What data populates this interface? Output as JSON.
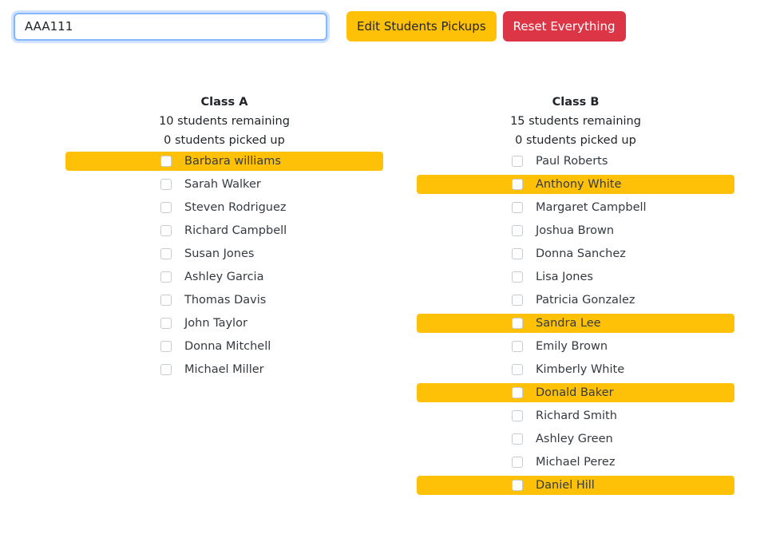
{
  "search": {
    "value": "AAA111"
  },
  "buttons": {
    "edit_label": "Edit Students Pickups",
    "reset_label": "Reset Everything"
  },
  "classes": [
    {
      "title": "Class A",
      "remaining": "10 students remaining",
      "picked_up": "0 students picked up",
      "students": [
        {
          "name": "Barbara williams",
          "highlighted": true,
          "checked": false
        },
        {
          "name": "Sarah Walker",
          "highlighted": false,
          "checked": false
        },
        {
          "name": "Steven Rodriguez",
          "highlighted": false,
          "checked": false
        },
        {
          "name": "Richard Campbell",
          "highlighted": false,
          "checked": false
        },
        {
          "name": "Susan Jones",
          "highlighted": false,
          "checked": false
        },
        {
          "name": "Ashley Garcia",
          "highlighted": false,
          "checked": false
        },
        {
          "name": "Thomas Davis",
          "highlighted": false,
          "checked": false
        },
        {
          "name": "John Taylor",
          "highlighted": false,
          "checked": false
        },
        {
          "name": "Donna Mitchell",
          "highlighted": false,
          "checked": false
        },
        {
          "name": "Michael Miller",
          "highlighted": false,
          "checked": false
        }
      ]
    },
    {
      "title": "Class B",
      "remaining": "15 students remaining",
      "picked_up": "0 students picked up",
      "students": [
        {
          "name": "Paul Roberts",
          "highlighted": false,
          "checked": false
        },
        {
          "name": "Anthony White",
          "highlighted": true,
          "checked": false
        },
        {
          "name": "Margaret Campbell",
          "highlighted": false,
          "checked": false
        },
        {
          "name": "Joshua Brown",
          "highlighted": false,
          "checked": false
        },
        {
          "name": "Donna Sanchez",
          "highlighted": false,
          "checked": false
        },
        {
          "name": "Lisa Jones",
          "highlighted": false,
          "checked": false
        },
        {
          "name": "Patricia Gonzalez",
          "highlighted": false,
          "checked": false
        },
        {
          "name": "Sandra Lee",
          "highlighted": true,
          "checked": false
        },
        {
          "name": "Emily Brown",
          "highlighted": false,
          "checked": false
        },
        {
          "name": "Kimberly White",
          "highlighted": false,
          "checked": false
        },
        {
          "name": "Donald Baker",
          "highlighted": true,
          "checked": false
        },
        {
          "name": "Richard Smith",
          "highlighted": false,
          "checked": false
        },
        {
          "name": "Ashley Green",
          "highlighted": false,
          "checked": false
        },
        {
          "name": "Michael Perez",
          "highlighted": false,
          "checked": false
        },
        {
          "name": "Daniel Hill",
          "highlighted": true,
          "checked": false
        }
      ]
    }
  ],
  "colors": {
    "highlight": "#ffc107",
    "danger": "#dc3545",
    "focus_border": "#86b7fe"
  }
}
